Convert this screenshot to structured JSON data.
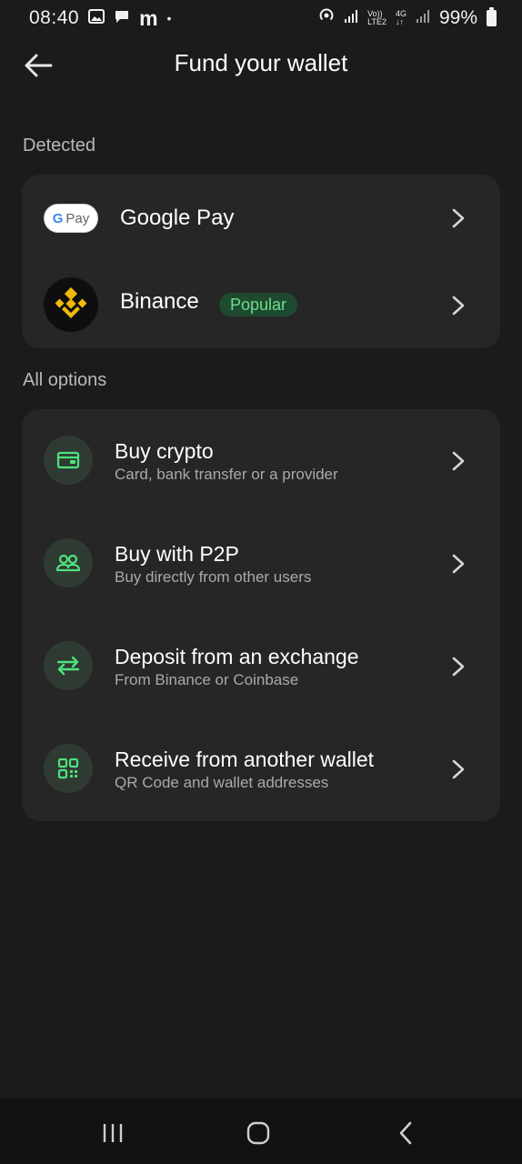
{
  "status_bar": {
    "time": "08:40",
    "m_label": "m",
    "dot": "•",
    "volte_top": "Vo))",
    "volte_bottom": "LTE2",
    "net_top": "4G",
    "net_bottom": "↓↑",
    "battery_text": "99%"
  },
  "header": {
    "title": "Fund your wallet",
    "back_icon": "arrow-left-icon"
  },
  "detected": {
    "label": "Detected",
    "items": [
      {
        "name": "Google Pay",
        "logo_text_g": "G",
        "logo_text_pay": "Pay",
        "icon": "google-pay-logo"
      },
      {
        "name": "Binance",
        "badge": "Popular",
        "icon": "binance-logo"
      }
    ]
  },
  "all_options": {
    "label": "All options",
    "items": [
      {
        "title": "Buy crypto",
        "subtitle": "Card, bank transfer or a provider",
        "icon": "wallet-card-icon"
      },
      {
        "title": "Buy with P2P",
        "subtitle": "Buy directly from other users",
        "icon": "users-icon"
      },
      {
        "title": "Deposit from an exchange",
        "subtitle": "From Binance or Coinbase",
        "icon": "swap-arrows-icon"
      },
      {
        "title": "Receive from another wallet",
        "subtitle": "QR Code and wallet addresses",
        "icon": "qr-code-icon"
      }
    ]
  },
  "colors": {
    "background": "#1b1b1b",
    "card": "#262626",
    "accent_green": "#6fdc8c",
    "binance_yellow": "#f0b90b"
  }
}
